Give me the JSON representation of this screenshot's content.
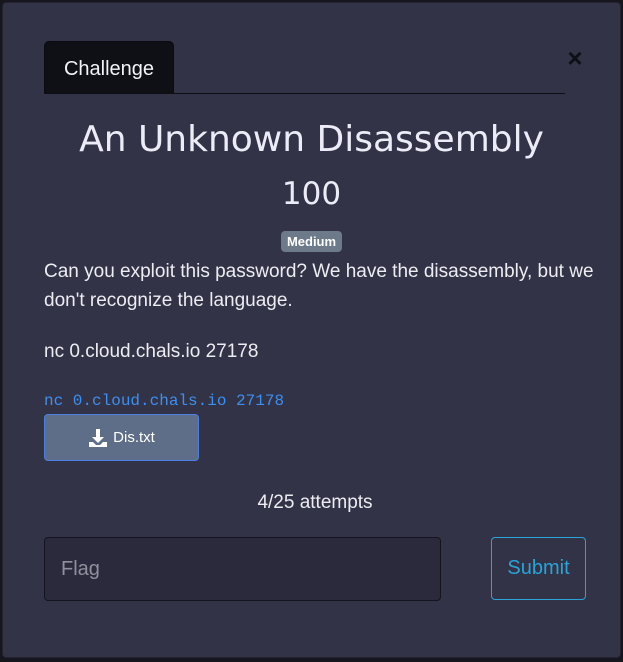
{
  "modal": {
    "close_label": "×",
    "tabs": [
      {
        "label": "Challenge"
      }
    ]
  },
  "challenge": {
    "title": "An Unknown Disassembly",
    "points": "100",
    "difficulty": "Medium",
    "description": "Can you exploit this password? We have the disassembly, but we don't recognize the language.",
    "connection_text": "nc 0.cloud.chals.io 27178",
    "connection_code": "nc 0.cloud.chals.io 27178",
    "file": {
      "name": "Dis.txt",
      "icon": "download-icon"
    },
    "attempts": "4/25 attempts"
  },
  "form": {
    "flag_placeholder": "Flag",
    "flag_value": "",
    "submit_label": "Submit"
  },
  "colors": {
    "modal_bg": "#333347",
    "tab_bg": "#0f0f16",
    "badge_bg": "#6c7a8a",
    "link": "#3e8ef0",
    "file_button_bg": "#5f6e88",
    "submit_accent": "#2aa3d9"
  }
}
